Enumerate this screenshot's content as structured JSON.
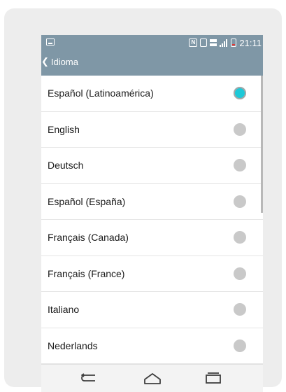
{
  "statusbar": {
    "time": "21:11"
  },
  "header": {
    "title": "Idioma"
  },
  "languages": {
    "items": [
      {
        "label": "Español (Latinoamérica)",
        "selected": true
      },
      {
        "label": "English",
        "selected": false
      },
      {
        "label": "Deutsch",
        "selected": false
      },
      {
        "label": "Español (España)",
        "selected": false
      },
      {
        "label": "Français (Canada)",
        "selected": false
      },
      {
        "label": "Français (France)",
        "selected": false
      },
      {
        "label": "Italiano",
        "selected": false
      },
      {
        "label": "Nederlands",
        "selected": false
      }
    ]
  },
  "colors": {
    "header_bg": "#7f97a6",
    "selected_radio": "#1dc9d8",
    "unselected_radio": "#c9c9c9"
  },
  "icons": {
    "back": "chevron-left-icon",
    "nav_back": "back-icon",
    "nav_home": "home-icon",
    "nav_recent": "recent-apps-icon"
  }
}
